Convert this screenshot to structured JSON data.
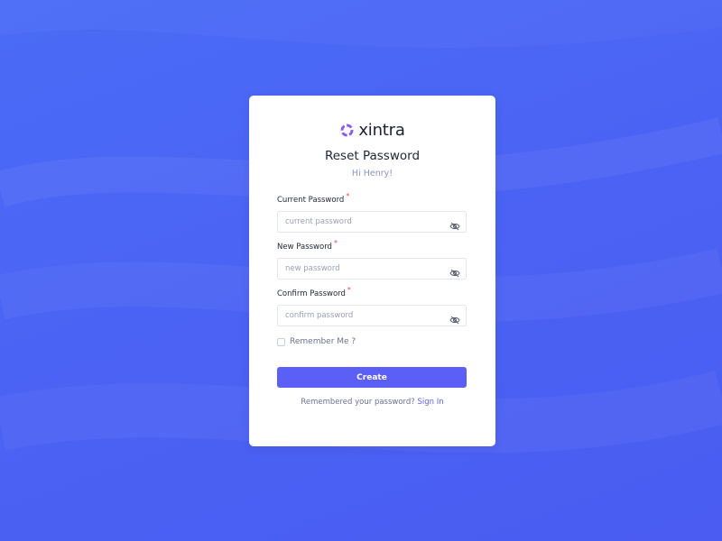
{
  "brand": {
    "name": "xintra"
  },
  "page": {
    "title": "Reset Password",
    "greeting": "Hi Henry!"
  },
  "fields": [
    {
      "label": "Current Password",
      "required_mark": "*",
      "placeholder": "current password",
      "value": ""
    },
    {
      "label": "New Password",
      "required_mark": "*",
      "placeholder": "new password",
      "value": ""
    },
    {
      "label": "Confirm Password",
      "required_mark": "*",
      "placeholder": "confirm password",
      "value": ""
    }
  ],
  "remember": {
    "label": "Remember Me ?",
    "checked": false
  },
  "actions": {
    "create_label": "Create"
  },
  "footer": {
    "text": "Remembered your password?",
    "link_label": "Sign In"
  },
  "icons": {
    "field_toggle": "eye-slash-icon",
    "brand": "logo-icon"
  },
  "colors": {
    "background": "#4b63f4",
    "primary": "#5b5ff5",
    "required": "#e8485b"
  }
}
